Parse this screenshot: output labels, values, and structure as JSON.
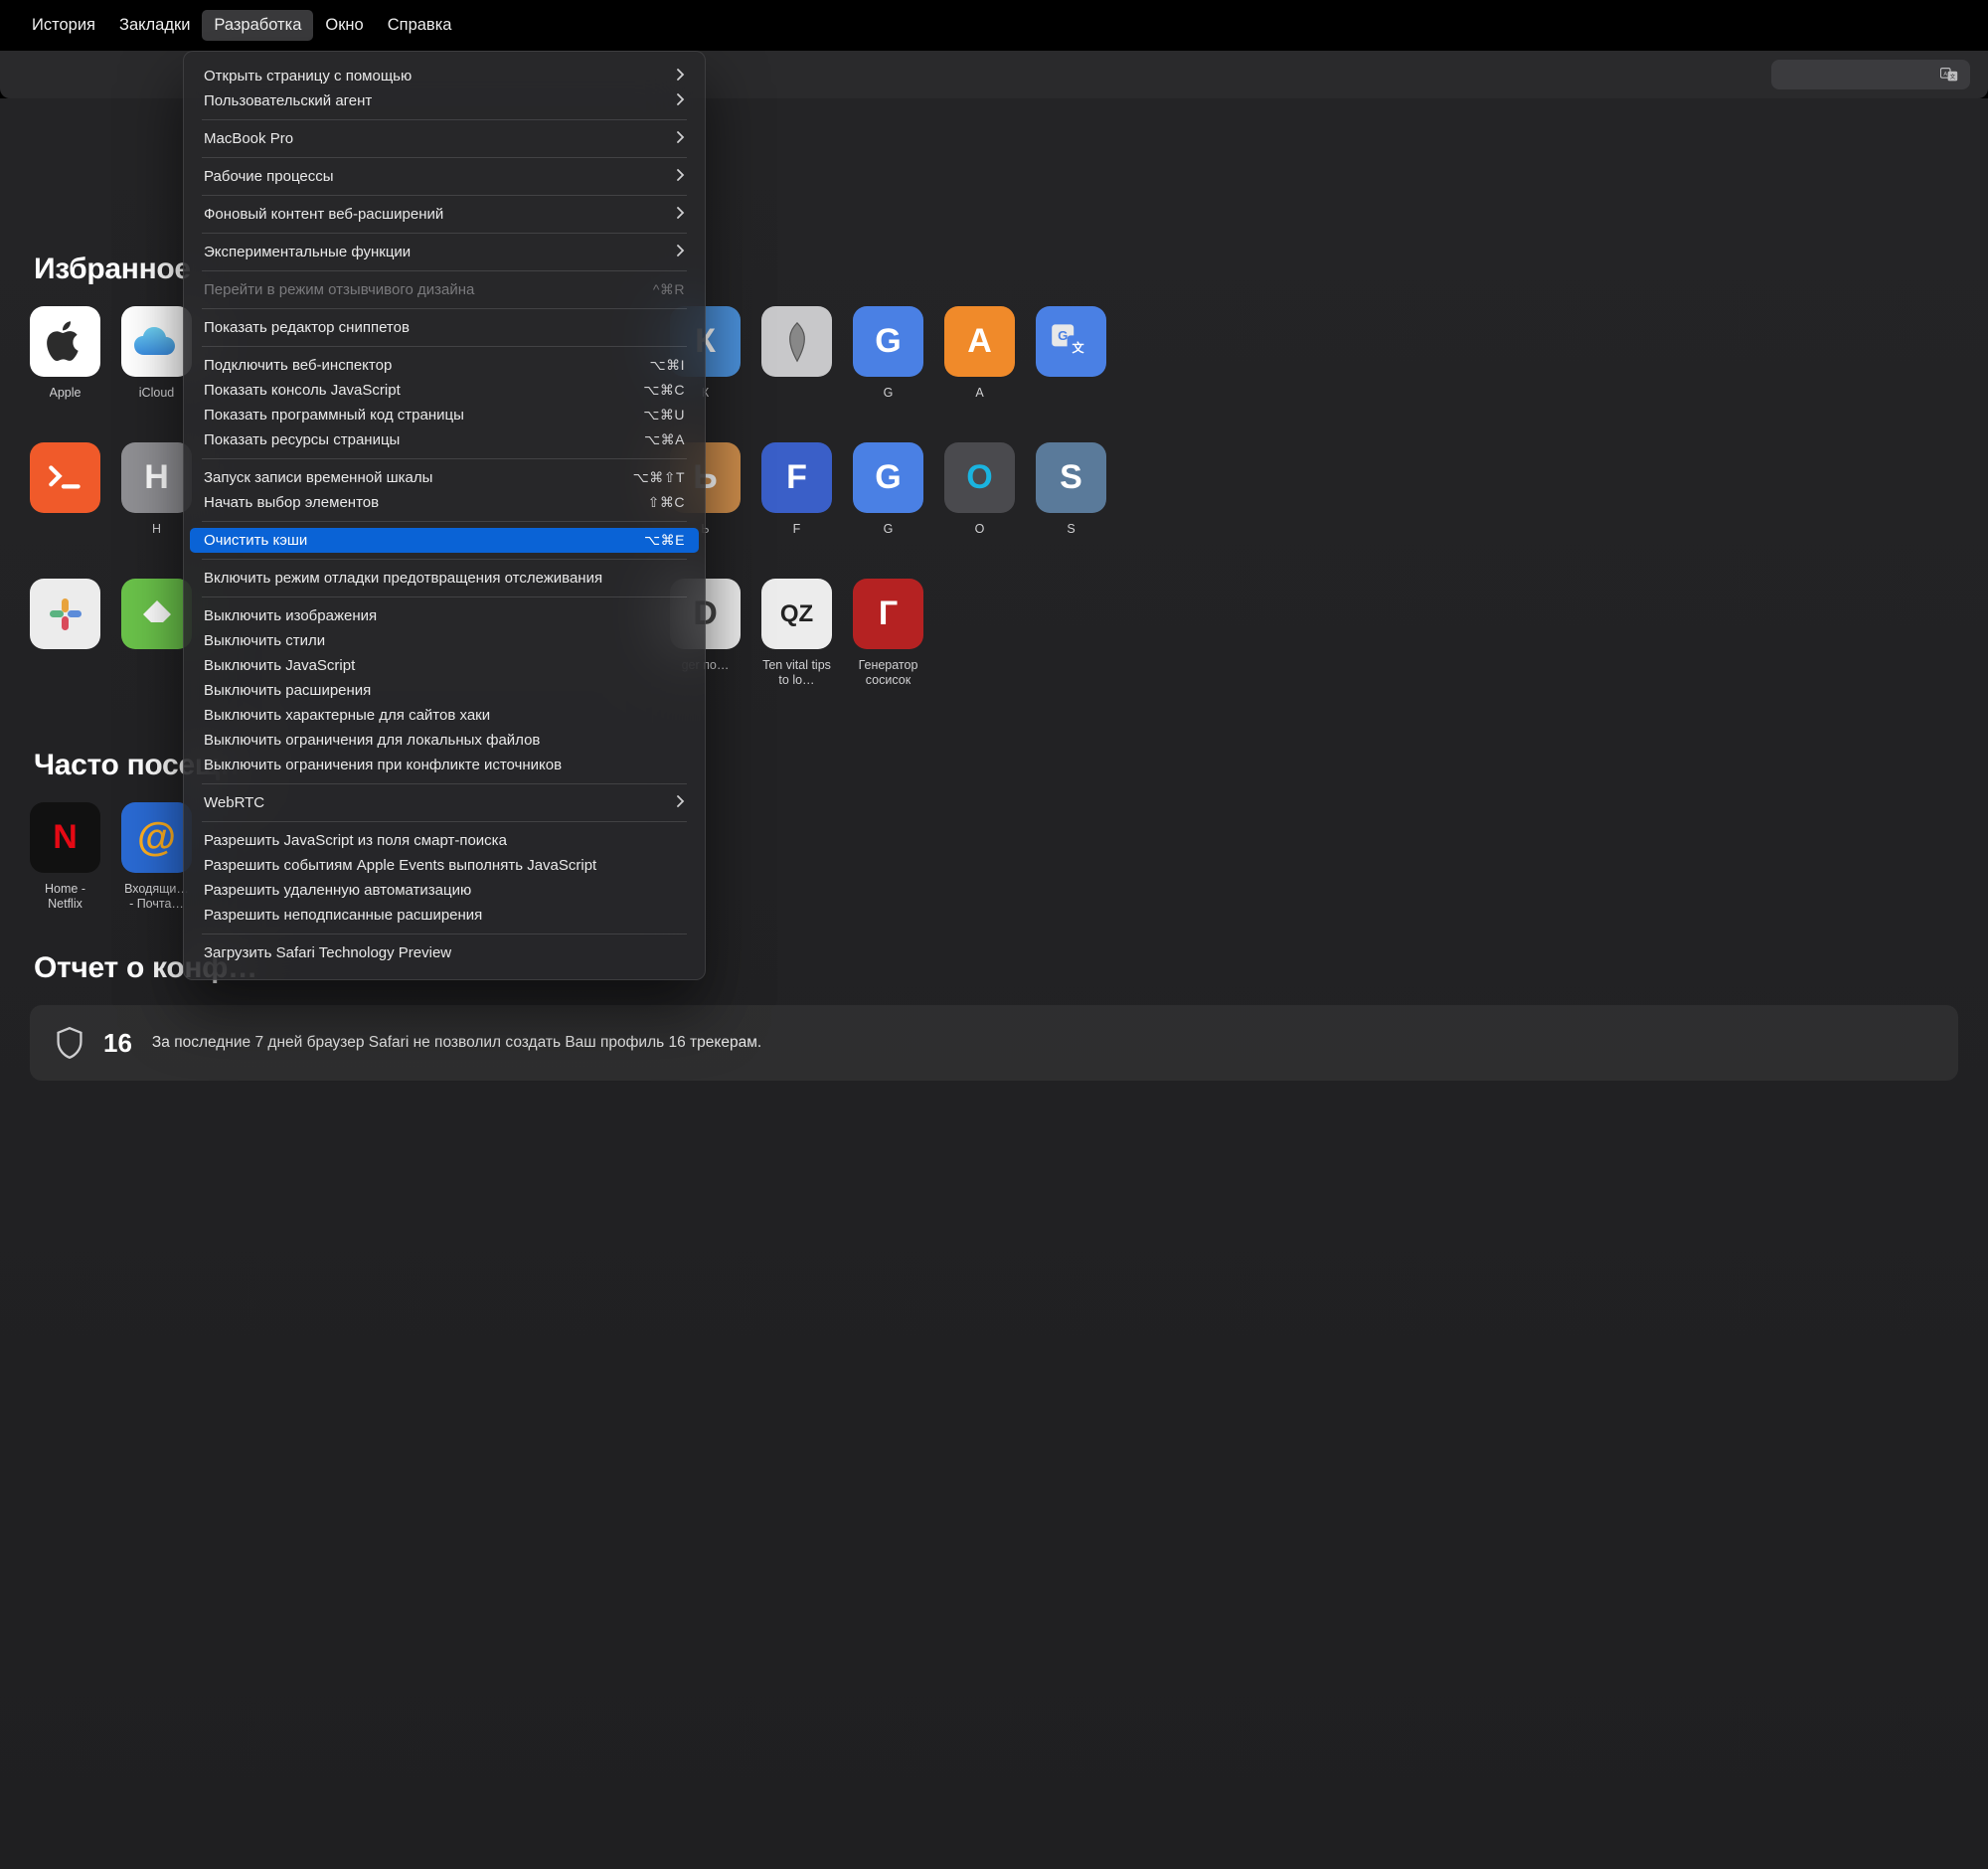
{
  "menubar": {
    "items": [
      {
        "label": "История"
      },
      {
        "label": "Закладки"
      },
      {
        "label": "Разработка",
        "active": true
      },
      {
        "label": "Окно"
      },
      {
        "label": "Справка"
      }
    ]
  },
  "dropdown": {
    "groups": [
      [
        {
          "label": "Открыть страницу с помощью",
          "sub": true
        },
        {
          "label": "Пользовательский агент",
          "sub": true
        }
      ],
      [
        {
          "label": "MacBook Pro",
          "sub": true
        }
      ],
      [
        {
          "label": "Рабочие процессы",
          "sub": true
        }
      ],
      [
        {
          "label": "Фоновый контент веб-расширений",
          "sub": true
        }
      ],
      [
        {
          "label": "Экспериментальные функции",
          "sub": true
        }
      ],
      [
        {
          "label": "Перейти в режим отзывчивого дизайна",
          "shortcut": "^⌘R",
          "disabled": true
        }
      ],
      [
        {
          "label": "Показать редактор сниппетов"
        }
      ],
      [
        {
          "label": "Подключить веб-инспектор",
          "shortcut": "⌥⌘I"
        },
        {
          "label": "Показать консоль JavaScript",
          "shortcut": "⌥⌘C"
        },
        {
          "label": "Показать программный код страницы",
          "shortcut": "⌥⌘U"
        },
        {
          "label": "Показать ресурсы страницы",
          "shortcut": "⌥⌘A"
        }
      ],
      [
        {
          "label": "Запуск записи временной шкалы",
          "shortcut": "⌥⌘⇧T"
        },
        {
          "label": "Начать выбор элементов",
          "shortcut": "⇧⌘C"
        }
      ],
      [
        {
          "label": "Очистить кэши",
          "shortcut": "⌥⌘E",
          "highlight": true
        }
      ],
      [
        {
          "label": "Включить режим отладки предотвращения отслеживания"
        }
      ],
      [
        {
          "label": "Выключить изображения"
        },
        {
          "label": "Выключить стили"
        },
        {
          "label": "Выключить JavaScript"
        },
        {
          "label": "Выключить расширения"
        },
        {
          "label": "Выключить характерные для сайтов хаки"
        },
        {
          "label": "Выключить ограничения для локальных файлов"
        },
        {
          "label": "Выключить ограничения при конфликте источников"
        }
      ],
      [
        {
          "label": "WebRTC",
          "sub": true
        }
      ],
      [
        {
          "label": "Разрешить JavaScript из поля смарт-поиска"
        },
        {
          "label": "Разрешить событиям Apple Events выполнять JavaScript"
        },
        {
          "label": "Разрешить удаленную автоматизацию"
        },
        {
          "label": "Разрешить неподписанные расширения"
        }
      ],
      [
        {
          "label": "Загрузить Safari Technology Preview"
        }
      ]
    ]
  },
  "sections": {
    "favorites_title": "Избранное",
    "visited_title": "Часто посещ…",
    "report_title": "Отчет о конф…"
  },
  "favorites_rows": [
    [
      {
        "label": "Apple",
        "bg": "#ffffff",
        "fg": "#2c2c2c",
        "glyph": "apple"
      },
      {
        "label": "iCloud",
        "bg": "#ffffff",
        "fg": "#2c2c2c",
        "glyph": "cloud"
      },
      {
        "label": "",
        "bg": "",
        "fg": "",
        "glyph": ""
      },
      {
        "label": "",
        "bg": "",
        "fg": "",
        "glyph": ""
      },
      {
        "label": "",
        "bg": "",
        "fg": "",
        "glyph": ""
      },
      {
        "label": "",
        "bg": "",
        "fg": "",
        "glyph": ""
      },
      {
        "label": "",
        "bg": "",
        "fg": "",
        "glyph": ""
      },
      {
        "label": "К",
        "bg": "#4a8fd8",
        "fg": "#fff",
        "glyph": "К"
      },
      {
        "label": "",
        "bg": "#c8c8ca",
        "fg": "#444",
        "glyph": "metin"
      },
      {
        "label": "G",
        "bg": "#4a80e4",
        "fg": "#fff",
        "glyph": "G"
      },
      {
        "label": "А",
        "bg": "#f08a2a",
        "fg": "#fff",
        "glyph": "А"
      },
      {
        "label": "",
        "bg": "#4a80e4",
        "fg": "#fff",
        "glyph": "gtrans"
      }
    ],
    [
      {
        "label": "",
        "bg": "#f05a2a",
        "fg": "#fff",
        "glyph": "term"
      },
      {
        "label": "H",
        "bg": "#8f8f93",
        "fg": "#fff",
        "glyph": "H"
      },
      {
        "label": "",
        "bg": "",
        "fg": "",
        "glyph": ""
      },
      {
        "label": "",
        "bg": "",
        "fg": "",
        "glyph": ""
      },
      {
        "label": "",
        "bg": "",
        "fg": "",
        "glyph": ""
      },
      {
        "label": "",
        "bg": "",
        "fg": "",
        "glyph": ""
      },
      {
        "label": "",
        "bg": "",
        "fg": "",
        "glyph": ""
      },
      {
        "label": "Ь",
        "bg": "#c98a4a",
        "fg": "#fff",
        "glyph": "Ь"
      },
      {
        "label": "F",
        "bg": "#3a5fc8",
        "fg": "#fff",
        "glyph": "F"
      },
      {
        "label": "G",
        "bg": "#4a80e4",
        "fg": "#fff",
        "glyph": "G"
      },
      {
        "label": "О",
        "bg": "#4a4a4e",
        "fg": "#1ab4e0",
        "glyph": "O"
      },
      {
        "label": "S",
        "bg": "#5a7a9a",
        "fg": "#fff",
        "glyph": "S"
      }
    ],
    [
      {
        "label": "",
        "bg": "#ececec",
        "fg": "#444",
        "glyph": "slack"
      },
      {
        "label": "",
        "bg": "#6ac24a",
        "fg": "#fff",
        "glyph": "feedly"
      },
      {
        "label": "",
        "bg": "",
        "fg": "",
        "glyph": ""
      },
      {
        "label": "",
        "bg": "",
        "fg": "",
        "glyph": ""
      },
      {
        "label": "",
        "bg": "",
        "fg": "",
        "glyph": ""
      },
      {
        "label": "",
        "bg": "",
        "fg": "",
        "glyph": ""
      },
      {
        "label": "",
        "bg": "",
        "fg": "",
        "glyph": ""
      },
      {
        "label": "ger\nпо…",
        "bg": "#ececec",
        "fg": "#444",
        "glyph": "D"
      },
      {
        "label": "Ten vital tips to lo…",
        "bg": "#ececec",
        "fg": "#222",
        "glyph": "QZ"
      },
      {
        "label": "Генератор сосисок",
        "bg": "#b52222",
        "fg": "#fff",
        "glyph": "Г"
      }
    ]
  ],
  "visited": [
    {
      "label": "Home - Netflix",
      "bg": "#111",
      "fg": "#e50914",
      "glyph": "N"
    },
    {
      "label": "Входящи… - Почта…",
      "bg": "#2a6ad3",
      "fg": "#ffb020",
      "glyph": "@"
    }
  ],
  "report": {
    "count": "16",
    "text": "За последние 7 дней браузер Safari не позволил создать Ваш профиль 16 трекерам."
  }
}
